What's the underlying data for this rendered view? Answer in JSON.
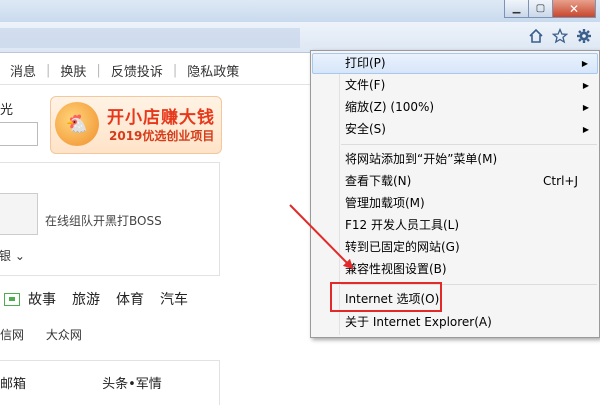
{
  "window": {
    "minimize_label": "▁",
    "maximize_label": "▢",
    "close_label": "✕"
  },
  "toolbar": {
    "icons": [
      "home-icon",
      "favorites-star-icon",
      "settings-gear-icon"
    ]
  },
  "topnav": {
    "items": [
      "消息",
      "换肤",
      "反馈投诉",
      "隐私政策"
    ]
  },
  "page": {
    "side_text": "光",
    "banner": {
      "title": "开小店赚大钱",
      "subtitle": "2019优选创业项目"
    },
    "panel": {
      "boss_text": "在线组队开黑打BOSS",
      "partial_label": "银"
    },
    "categories": [
      "故事",
      "旅游",
      "体育",
      "汽车"
    ],
    "links": [
      "信网",
      "大众网"
    ],
    "bottom": {
      "left": "邮箱",
      "right": "头条•军情"
    }
  },
  "menu": {
    "items": [
      {
        "label": "打印(P)",
        "submenu": true,
        "highlighted": true
      },
      {
        "label": "文件(F)",
        "submenu": true
      },
      {
        "label": "缩放(Z) (100%)",
        "submenu": true
      },
      {
        "label": "安全(S)",
        "submenu": true
      },
      {
        "label": "将网站添加到“开始”菜单(M)"
      },
      {
        "label": "查看下载(N)",
        "shortcut": "Ctrl+J"
      },
      {
        "label": "管理加载项(M)"
      },
      {
        "label": "F12 开发人员工具(L)"
      },
      {
        "label": "转到已固定的网站(G)"
      },
      {
        "label": "兼容性视图设置(B)"
      },
      {
        "label": "Internet 选项(O)",
        "annotated": true
      },
      {
        "label": "关于 Internet Explorer(A)"
      }
    ],
    "arrow_glyph": "▶"
  },
  "colors": {
    "annotation_red": "#e12b2b",
    "menu_highlight": "#d6e6fa"
  }
}
